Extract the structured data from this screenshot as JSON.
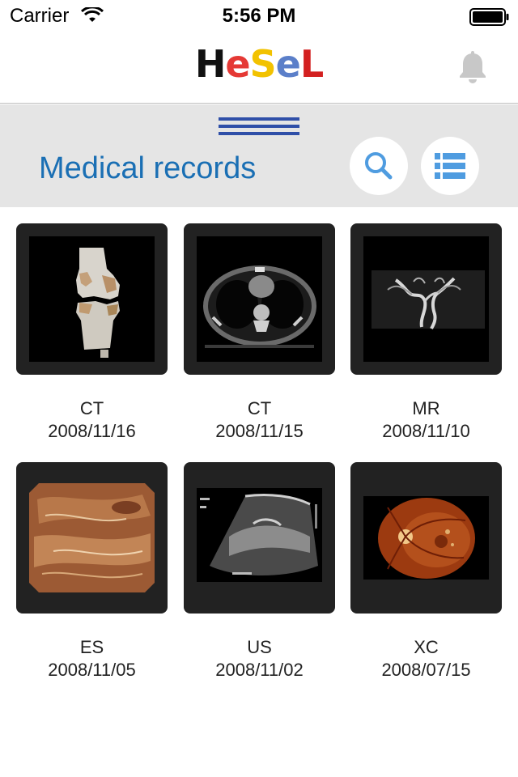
{
  "status_bar": {
    "carrier": "Carrier",
    "time": "5:56 PM"
  },
  "navbar": {
    "logo_letters": [
      {
        "char": "H",
        "color": "#111111"
      },
      {
        "char": "e",
        "color": "#e53935"
      },
      {
        "char": "S",
        "color": "#f2c200"
      },
      {
        "char": "e",
        "color": "#5b7fc9"
      },
      {
        "char": "L",
        "color": "#d32020"
      }
    ],
    "bell_color": "#c8c8c8"
  },
  "header": {
    "title": "Medical records",
    "accent": "#1a6fb4",
    "handle_color": "#2f4fa8"
  },
  "records": [
    {
      "modality": "CT",
      "date": "2008/11/16",
      "image": "knee-3d-ct-image"
    },
    {
      "modality": "CT",
      "date": "2008/11/15",
      "image": "chest-ct-image"
    },
    {
      "modality": "MR",
      "date": "2008/11/10",
      "image": "brain-angiography-mr-image"
    },
    {
      "modality": "ES",
      "date": "2008/11/05",
      "image": "endoscopy-image"
    },
    {
      "modality": "US",
      "date": "2008/11/02",
      "image": "ultrasound-image"
    },
    {
      "modality": "XC",
      "date": "2008/07/15",
      "image": "retina-fundus-image"
    }
  ]
}
